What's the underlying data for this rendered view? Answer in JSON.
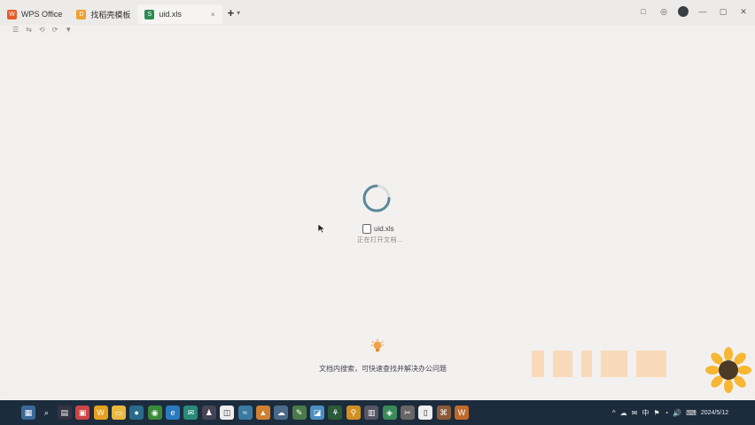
{
  "tabs": [
    {
      "label": "WPS Office",
      "icon": "wps-logo-icon"
    },
    {
      "label": "找稻壳模板",
      "icon": "template-icon"
    },
    {
      "label": "uid.xls",
      "icon": "xls-file-icon",
      "active": true
    }
  ],
  "tab_close": "×",
  "tab_add": "+",
  "tab_more": "▾",
  "window_controls": [
    "□",
    "◎",
    "—",
    "▢",
    "✕"
  ],
  "quick_toolbar": [
    "☰",
    "⇆",
    "⟲",
    "⟳",
    "▼"
  ],
  "loading": {
    "file_name": "uid.xls",
    "status_text": "正在打开文档..."
  },
  "tip": {
    "text": "文档内搜索，可快速查找并解决办公问题"
  },
  "taskbar": {
    "icons": [
      "start-icon",
      "search-icon",
      "task-view-icon",
      "store-icon",
      "wps-icon",
      "folder-icon",
      "app-icon",
      "chrome-icon",
      "edge-icon",
      "mail-icon",
      "game-icon",
      "chat-icon",
      "scroll-icon",
      "cloud-icon",
      "image-icon",
      "tool-icon",
      "wechat-icon",
      "search-app-icon",
      "calc-icon",
      "settings-icon",
      "media-icon",
      "video-icon",
      "note-icon",
      "hub-icon",
      "wps-writer-icon"
    ],
    "tray_text": [
      "^",
      "☁",
      "✉",
      "中",
      "⚑",
      "◔",
      "🔊",
      "⌨"
    ],
    "date": "2024/5/12"
  }
}
